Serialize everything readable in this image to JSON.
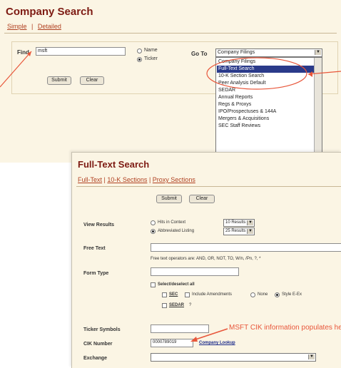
{
  "company_search": {
    "title": "Company Search",
    "nav": {
      "simple": "Simple",
      "sep": "|",
      "detailed": "Detailed"
    },
    "find_label": "Find",
    "find_value": "msft",
    "radio_name": "Name",
    "radio_ticker": "Ticker",
    "goto_label": "Go To",
    "goto_selected": "Company Filings",
    "submit": "Submit",
    "clear": "Clear",
    "dropdown_items": [
      "Company Filings",
      "Full-Text Search",
      "10-K Section Search",
      "Peer Analysis Default",
      "SEDAR",
      "Annual Reports",
      "Regs & Proxys",
      "IPO/Prospectuses & 144A",
      "Mergers & Acquisitions",
      "SEC Staff Reviews"
    ]
  },
  "full_text_search": {
    "title": "Full-Text Search",
    "nav": {
      "full_text": "Full-Text",
      "sep1": "|",
      "tenk": "10-K Sections",
      "sep2": "|",
      "proxy": "Proxy Sections"
    },
    "submit": "Submit",
    "clear": "Clear",
    "view_results_label": "View Results",
    "view_option_hits": "Hits in Context",
    "view_option_abbrev": "Abbreviated Listing",
    "hits_count": "10 Results",
    "abbrev_count": "25 Results",
    "free_text_label": "Free Text",
    "operators_hint": "Free text operators are: AND, OR, NOT, TO, W/n, /Pn, ?, *",
    "form_type_label": "Form Type",
    "select_deselect": "Select/deselect all",
    "sec_label": "SEC",
    "include_amendments": "Include Amendments",
    "radio_none": "None",
    "radio_style": "Style E-Ex",
    "sedar_label": "SEDAR",
    "sedar_extra": "?",
    "ticker_label": "Ticker Symbols",
    "cik_label": "CIK Number",
    "cik_value": "0000789019",
    "company_lookup": "Company Lookup",
    "exchange_label": "Exchange"
  },
  "annotation": {
    "cik_note": "MSFT CIK information populates here"
  },
  "colors": {
    "title": "#7d1a12",
    "link": "#b04020",
    "panel_bg": "#fbf5e4",
    "annotation": "#e8563a",
    "selection": "#2a3a8a"
  }
}
